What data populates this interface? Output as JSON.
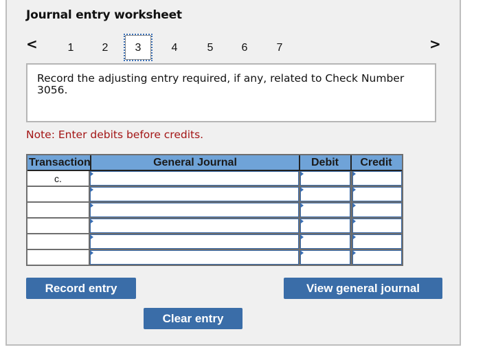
{
  "worksheet": {
    "title": "Journal entry worksheet",
    "nav": {
      "prev_icon": "chevron-left-icon",
      "prev_glyph": "<",
      "next_icon": "chevron-right-icon",
      "next_glyph": ">",
      "tabs": [
        "1",
        "2",
        "3",
        "4",
        "5",
        "6",
        "7"
      ],
      "active_tab": "3"
    },
    "prompt": "Record the adjusting entry required, if any, related to Check Number 3056.",
    "note": "Note: Enter debits before credits."
  },
  "table": {
    "columns": [
      "Transaction",
      "General Journal",
      "Debit",
      "Credit"
    ],
    "rows": [
      {
        "transaction": "c.",
        "account": "",
        "debit": "",
        "credit": ""
      },
      {
        "transaction": "",
        "account": "",
        "debit": "",
        "credit": ""
      },
      {
        "transaction": "",
        "account": "",
        "debit": "",
        "credit": ""
      },
      {
        "transaction": "",
        "account": "",
        "debit": "",
        "credit": ""
      },
      {
        "transaction": "",
        "account": "",
        "debit": "",
        "credit": ""
      },
      {
        "transaction": "",
        "account": "",
        "debit": "",
        "credit": ""
      }
    ]
  },
  "buttons": {
    "record": "Record entry",
    "clear": "Clear entry",
    "view": "View general journal"
  },
  "colors": {
    "header_bg": "#6fa3d8",
    "button_bg": "#3a6da8",
    "note_text": "#a31515"
  }
}
